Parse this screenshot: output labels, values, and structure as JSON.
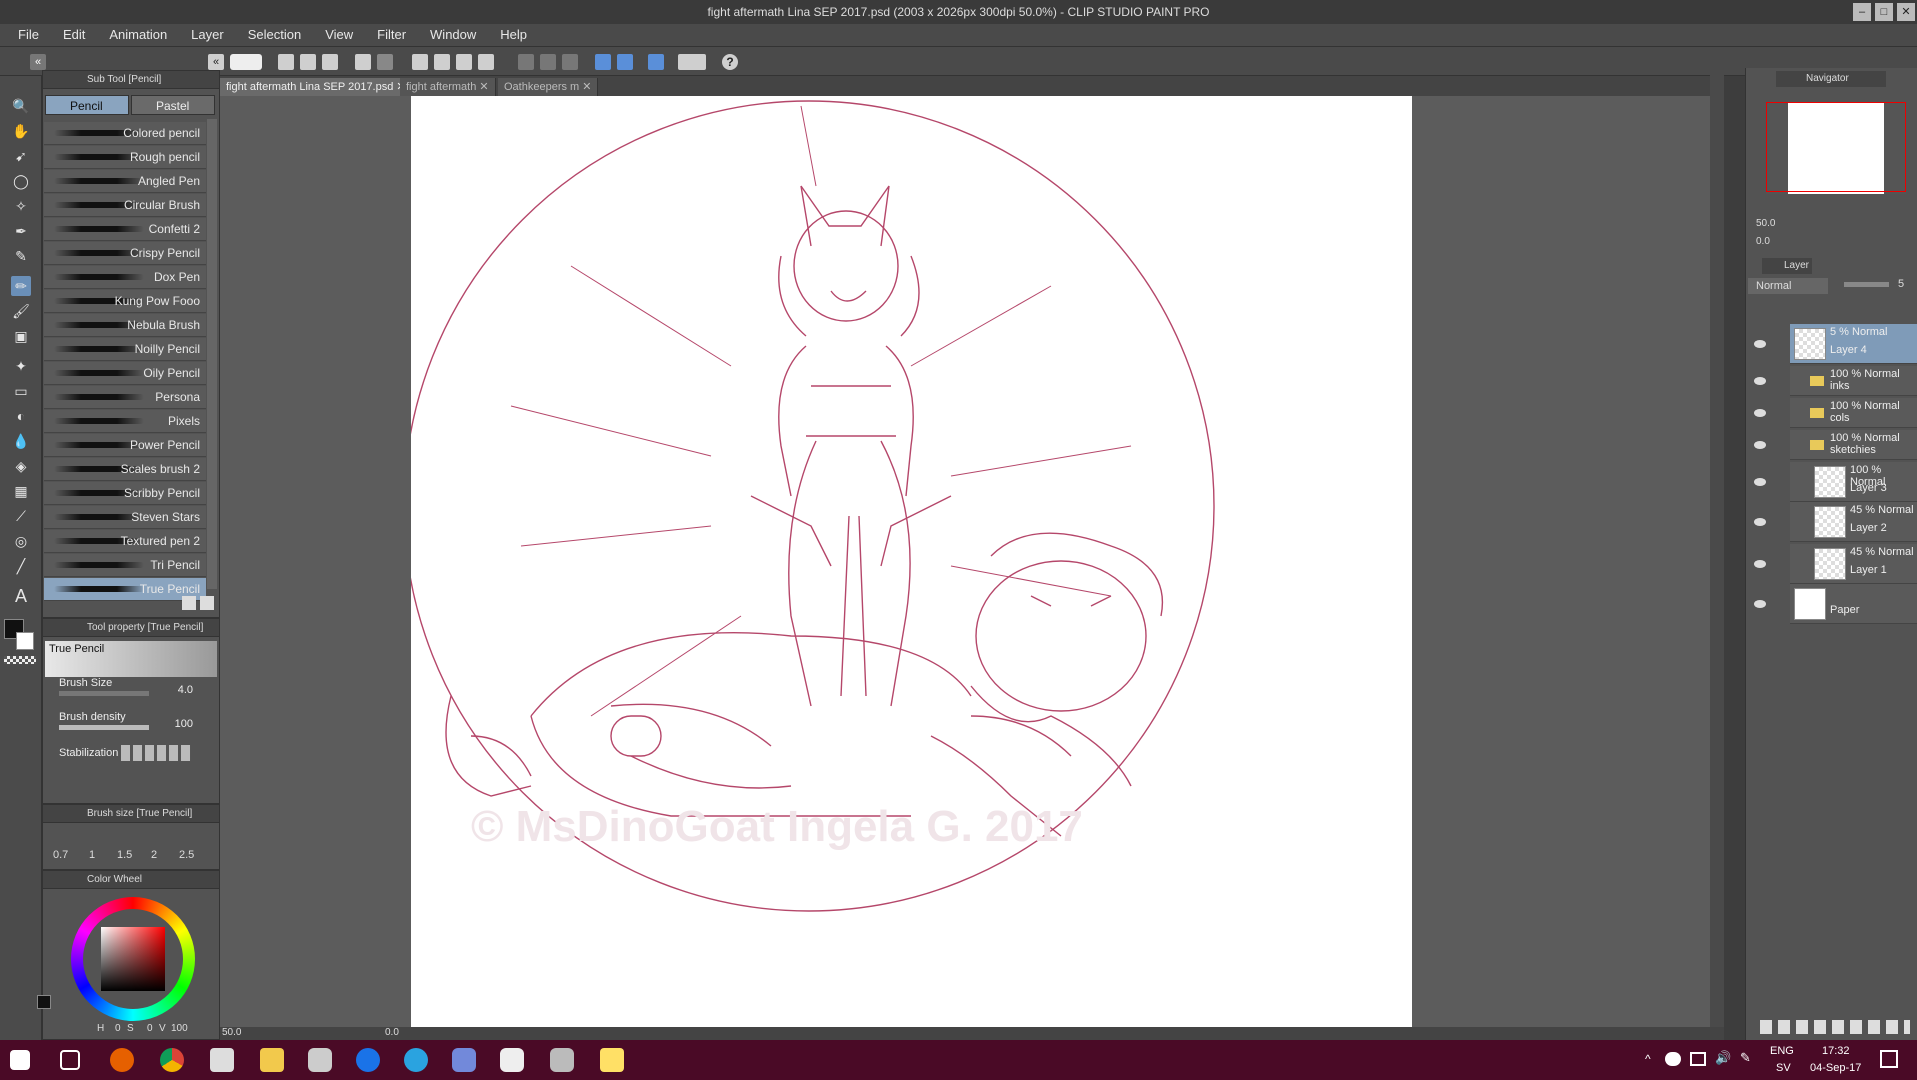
{
  "window": {
    "title": "fight aftermath Lina SEP 2017.psd (2003 x 2026px 300dpi 50.0%) - CLIP STUDIO PAINT PRO"
  },
  "menu": [
    "File",
    "Edit",
    "Animation",
    "Layer",
    "Selection",
    "View",
    "Filter",
    "Window",
    "Help"
  ],
  "subtool": {
    "header": "Sub Tool [Pencil]",
    "tabs": [
      "Pencil",
      "Pastel"
    ],
    "brushes": [
      "Colored pencil",
      "Rough pencil",
      "Angled Pen",
      "Circular Brush",
      "Confetti 2",
      "Crispy Pencil",
      "Dox Pen",
      "Kung Pow Fooo",
      "Nebula Brush",
      "Noilly Pencil",
      "Oily Pencil",
      "Persona",
      "Pixels",
      "Power Pencil",
      "Scales brush 2",
      "Scribby Pencil",
      "Steven Stars",
      "Textured pen 2",
      "Tri Pencil",
      "True Pencil"
    ],
    "selected": "True Pencil"
  },
  "toolprop": {
    "header": "Tool property [True Pencil]",
    "preset": "True Pencil",
    "brush_size_label": "Brush Size",
    "brush_size_value": "4.0",
    "density_label": "Brush density",
    "density_value": "100",
    "stab_label": "Stabilization"
  },
  "brushsize": {
    "header": "Brush size [True Pencil]",
    "values": [
      "0.7",
      "1",
      "1.5",
      "2",
      "2.5"
    ]
  },
  "colorwheel": {
    "header": "Color Wheel",
    "h_label": "H",
    "h_value": "0",
    "s_label": "S",
    "s_value": "0",
    "v_label": "V",
    "v_value": "100"
  },
  "tabs": [
    "fight aftermath Lina SEP 2017.psd",
    "fight aftermath",
    "Oathkeepers m"
  ],
  "canvas": {
    "zoom": "50.0",
    "angle": "0.0",
    "watermark": "© MsDinoGoat Ingela G. 2017"
  },
  "navigator": {
    "header": "Navigator",
    "zoom": "50.0",
    "angle": "0.0"
  },
  "layer": {
    "header": "Layer",
    "blend": "Normal",
    "opacity": "5",
    "rows": [
      {
        "mode": "5 % Normal",
        "name": "Layer 4"
      },
      {
        "mode": "100 % Normal",
        "name": "inks"
      },
      {
        "mode": "100 % Normal",
        "name": "cols"
      },
      {
        "mode": "100 % Normal",
        "name": "sketchies"
      },
      {
        "mode": "100 % Normal",
        "name": "Layer 3"
      },
      {
        "mode": "45 % Normal",
        "name": "Layer 2"
      },
      {
        "mode": "45 % Normal",
        "name": "Layer 1"
      },
      {
        "mode": "",
        "name": "Paper"
      }
    ]
  },
  "taskbar": {
    "lang": "ENG",
    "region": "SV",
    "time": "17:32",
    "date": "04-Sep-17"
  },
  "colors": {
    "line": "#b5476a",
    "taskbar": "#4a0a26",
    "selection": "#8aa4bf"
  }
}
